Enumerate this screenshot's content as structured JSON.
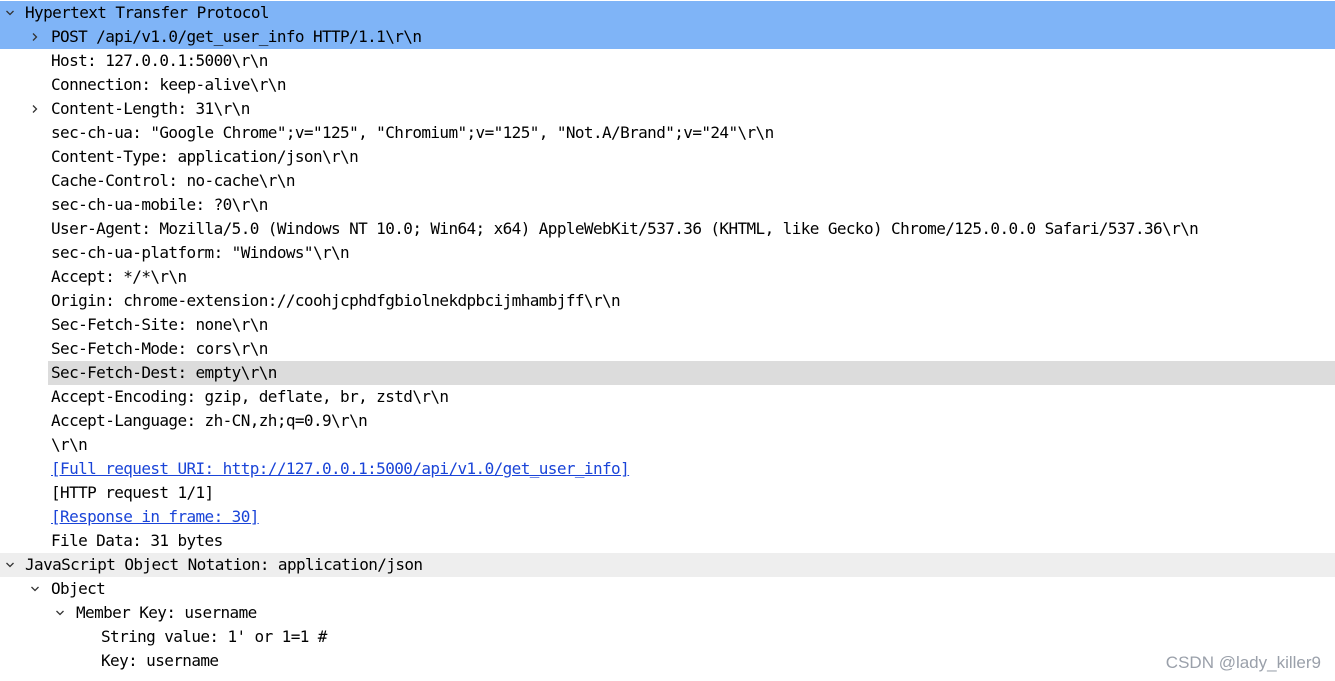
{
  "packet_details": {
    "http": {
      "label": "Hypertext Transfer Protocol",
      "request_line": "POST /api/v1.0/get_user_info HTTP/1.1\\r\\n",
      "headers": [
        "Host: 127.0.0.1:5000\\r\\n",
        "Connection: keep-alive\\r\\n",
        "Content-Length: 31\\r\\n",
        "sec-ch-ua: \"Google Chrome\";v=\"125\", \"Chromium\";v=\"125\", \"Not.A/Brand\";v=\"24\"\\r\\n",
        "Content-Type: application/json\\r\\n",
        "Cache-Control: no-cache\\r\\n",
        "sec-ch-ua-mobile: ?0\\r\\n",
        "User-Agent: Mozilla/5.0 (Windows NT 10.0; Win64; x64) AppleWebKit/537.36 (KHTML, like Gecko) Chrome/125.0.0.0 Safari/537.36\\r\\n",
        "sec-ch-ua-platform: \"Windows\"\\r\\n",
        "Accept: */*\\r\\n",
        "Origin: chrome-extension://coohjcphdfgbiolnekdpbcijmhambjff\\r\\n",
        "Sec-Fetch-Site: none\\r\\n",
        "Sec-Fetch-Mode: cors\\r\\n",
        "Sec-Fetch-Dest: empty\\r\\n",
        "Accept-Encoding: gzip, deflate, br, zstd\\r\\n",
        "Accept-Language: zh-CN,zh;q=0.9\\r\\n"
      ],
      "crlf": "\\r\\n",
      "full_request_uri": "[Full request URI: http://127.0.0.1:5000/api/v1.0/get_user_info]",
      "http_request": "[HTTP request 1/1]",
      "response_in_frame": "[Response in frame: 30]",
      "file_data": "File Data: 31 bytes"
    },
    "json": {
      "label": "JavaScript Object Notation: application/json",
      "object_label": "Object",
      "member_key_label": "Member Key: username",
      "string_value": "String value: 1' or 1=1 #",
      "key": "Key: username"
    }
  },
  "watermark": "CSDN @lady_killer9",
  "icons": {
    "expanded": "chevron-down-icon",
    "collapsed": "chevron-right-icon"
  },
  "colors": {
    "selected_row": "#7fb4f7",
    "highlighted_row": "#dcdcdc",
    "link": "#1a44d8"
  }
}
